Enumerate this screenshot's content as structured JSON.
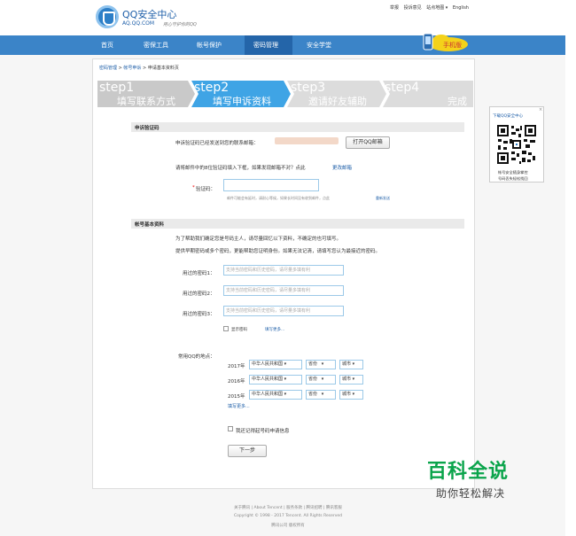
{
  "header": {
    "logo_title": "QQ安全中心",
    "logo_domain": "AQ.QQ.COM",
    "logo_slogan": "用心守护你的QQ",
    "top_links": [
      "举报",
      "投诉意见",
      "站点地图 ▾",
      "English"
    ]
  },
  "nav": {
    "items": [
      "首页",
      "密保工具",
      "帐号保护",
      "密码管理",
      "安全学堂"
    ],
    "active_index": 3,
    "cloud_text": "手机版"
  },
  "breadcrumb": {
    "items": [
      "密码管理",
      "帐号申诉",
      "申请基本资料页"
    ],
    "sep": ">"
  },
  "steps": [
    {
      "num": "step1",
      "label": "填写联系方式",
      "state": "done"
    },
    {
      "num": "step2",
      "label": "填写申诉资料",
      "state": "active"
    },
    {
      "num": "step3",
      "label": "邀请好友辅助",
      "state": "todo"
    },
    {
      "num": "step4",
      "label": "完成",
      "state": "todo"
    }
  ],
  "verify": {
    "section_title": "申诉验证码",
    "sent_text": "申诉验证码已经发送到您的联系邮箱：",
    "open_mail_button": "打开QQ邮箱",
    "instruction": "请将邮件中的8位验证码填入下框，如果发现邮箱不对？点此",
    "change_mail_link": "更改邮箱",
    "code_label": "验证码：",
    "code_required_mark": "*",
    "code_value": "",
    "hint": "邮件可能会有延时，请耐心等候，如果长时间没有收到邮件，点此",
    "resend_link": "重新发送"
  },
  "account": {
    "section_title": "帐号基本资料",
    "intro1": "为了帮助我们确定您是号码主人，请尽量回忆以下资料，不确定的也可填写。",
    "intro2": "提供早期密码或多个密码，更能帮助您证明身份。如果无法记清，请填写您认为最接近的密码。",
    "password_fields": [
      {
        "label": "用过的密码1：",
        "placeholder": "支持当前密码和历史密码，请尽量多填有利"
      },
      {
        "label": "用过的密码2：",
        "placeholder": "支持当前密码和历史密码，请尽量多填有利"
      },
      {
        "label": "用过的密码3：",
        "placeholder": "支持当前密码和历史密码，请尽量多填有利"
      }
    ],
    "show_password_label": "显示密码",
    "more_passwords_link": "填写更多...",
    "location_label": "常用QQ的地点：",
    "locations": [
      {
        "year": "2017年",
        "country": "中华人民共和国",
        "province": "省份",
        "city": "城市"
      },
      {
        "year": "2016年",
        "country": "中华人民共和国",
        "province": "省份",
        "city": "城市"
      },
      {
        "year": "2015年",
        "country": "中华人民共和国",
        "province": "省份",
        "city": "城市"
      }
    ],
    "more_locations_link": "填写更多...",
    "forgot_label": "我还记得起号码申请信息",
    "next_button": "下一步"
  },
  "qr_widget": {
    "title": "下载QQ安全中心",
    "caption_line1": "帐号安全随身掌控",
    "caption_line2": "号码丢失轻松找回",
    "close": "×"
  },
  "footer": {
    "links": [
      "关于腾讯",
      "About Tencent",
      "服务条款",
      "腾讯招聘",
      "腾讯客服"
    ],
    "copyright": "Copyright © 1998 - 2017 Tencent. All Rights Reserved",
    "company": "腾讯公司 版权所有"
  },
  "watermark": {
    "big": "百科全说",
    "small": "助你轻松解决"
  },
  "colors": {
    "nav": "#3b84c8",
    "nav_active": "#2465a9",
    "step_done": "#c9c9c9",
    "step_active": "#3fa4e5",
    "step_todo": "#dcdcdc",
    "link": "#1d5ea8",
    "watermark": "#0aa44b"
  }
}
